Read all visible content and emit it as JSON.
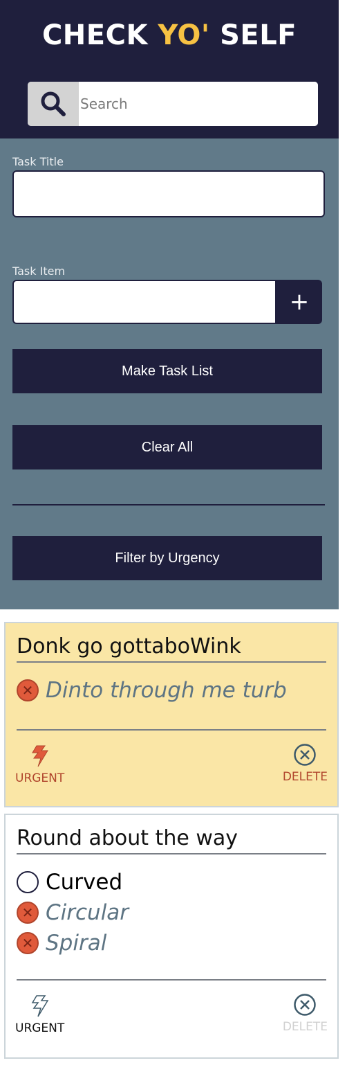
{
  "header": {
    "title_a": "CHECK ",
    "title_b": "YO'",
    "title_c": " SELF",
    "search_placeholder": "Search"
  },
  "form": {
    "task_title_label": "Task Title",
    "task_item_label": "Task Item",
    "add_item": "+",
    "make_list": "Make Task List",
    "clear_all": "Clear All",
    "filter": "Filter by Urgency"
  },
  "cards": [
    {
      "title": "Donk go gottaboWink",
      "items": [
        {
          "text": "Dinto through me turb",
          "checked": true
        }
      ],
      "urgent_label": "URGENT",
      "delete_label": "DELETE",
      "urgent": true,
      "bg": "#fae6a6"
    },
    {
      "title": "Round about the way",
      "items": [
        {
          "text": "Curved",
          "checked": false
        },
        {
          "text": "Circular",
          "checked": true
        },
        {
          "text": "Spiral",
          "checked": true
        }
      ],
      "urgent_label": "URGENT",
      "delete_label": "DELETE",
      "urgent": false,
      "bg": "#ffffff"
    }
  ],
  "colors": {
    "navy": "#1f1f3d",
    "slate": "#617a89",
    "yellow": "#f6c143",
    "urgent_red": "#b0452c"
  }
}
